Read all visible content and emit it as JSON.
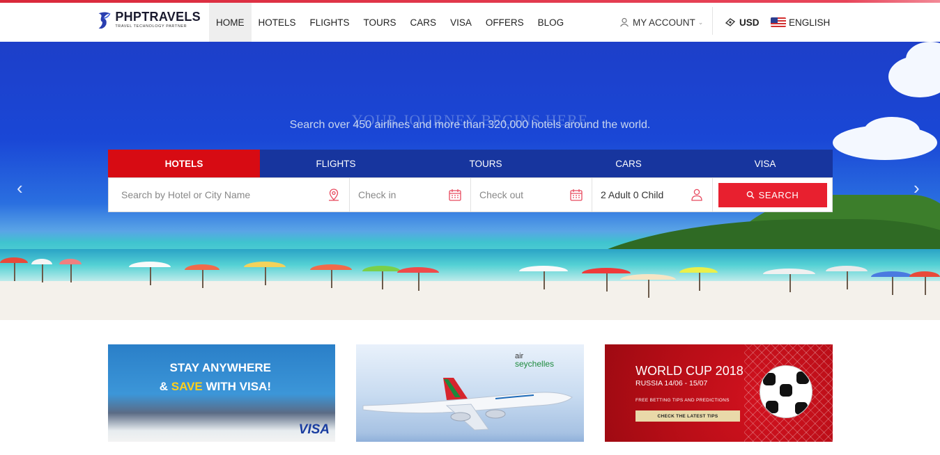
{
  "brand": {
    "name": "PHPTRAVELS",
    "tagline": "TRAVEL TECHNOLOGY PARTNER",
    "accent": "#e8202f"
  },
  "nav": {
    "items": [
      {
        "label": "HOME",
        "active": true
      },
      {
        "label": "HOTELS"
      },
      {
        "label": "FLIGHTS"
      },
      {
        "label": "TOURS"
      },
      {
        "label": "CARS"
      },
      {
        "label": "VISA"
      },
      {
        "label": "OFFERS"
      },
      {
        "label": "BLOG"
      }
    ],
    "account": "MY ACCOUNT",
    "currency": "USD",
    "language": "ENGLISH"
  },
  "hero": {
    "title": "YOUR JOURNEY BEGINS HERE",
    "subtitle": "Search over 450 airlines and more than 320,000 hotels around the world."
  },
  "search": {
    "tabs": [
      {
        "label": "HOTELS",
        "active": true
      },
      {
        "label": "FLIGHTS"
      },
      {
        "label": "TOURS"
      },
      {
        "label": "CARS"
      },
      {
        "label": "VISA"
      }
    ],
    "hotel_placeholder": "Search by Hotel or City Name",
    "checkin_placeholder": "Check in",
    "checkout_placeholder": "Check out",
    "guests_value": "2 Adult 0 Child",
    "button_label": "SEARCH"
  },
  "promos": {
    "visa": {
      "line1": "STAY ANYWHERE",
      "line2_pre": "& ",
      "line2_highlight": "SAVE",
      "line2_post": " WITH VISA!",
      "logo": "VISA"
    },
    "air": {
      "brand_top": "air",
      "brand_bottom": "seychelles"
    },
    "worldcup": {
      "title": "WORLD CUP 2018",
      "subtitle": "RUSSIA 14/06 - 15/07",
      "tips": "FREE BETTING TIPS AND PREDICTIONS",
      "button": "CHECK THE LATEST TIPS"
    }
  }
}
